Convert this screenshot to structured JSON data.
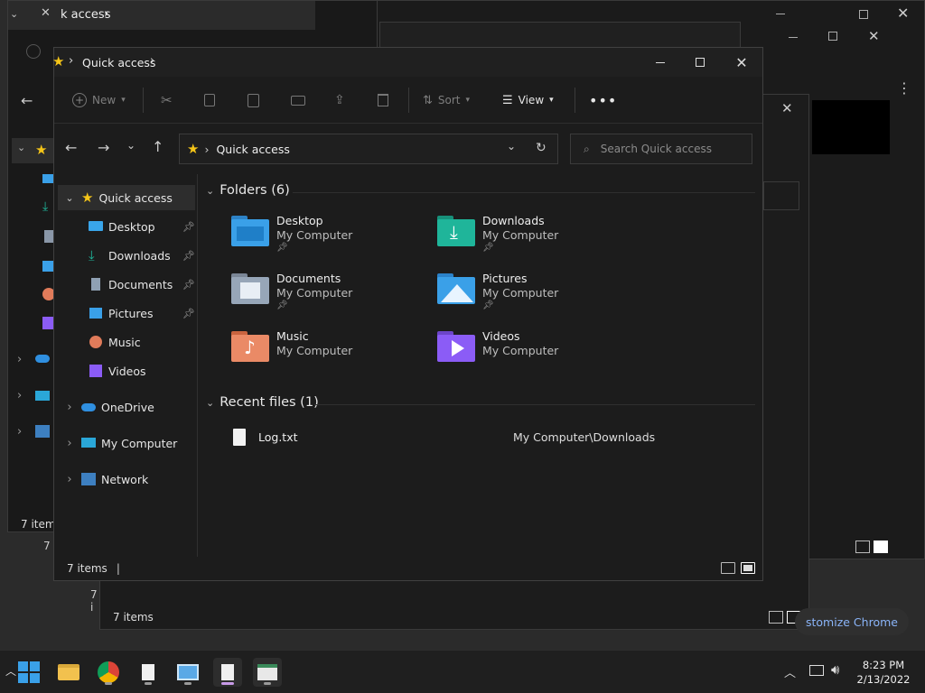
{
  "background_windows": {
    "top_title": "k access",
    "back_status": "7 items",
    "back2_status": "7 i",
    "back3_status": "7 i",
    "lower_status": "7 items",
    "chrome_label": "stomize Chrome"
  },
  "window": {
    "title": "Quick access",
    "toolbar": {
      "new_label": "New",
      "sort_label": "Sort",
      "view_label": "View"
    },
    "address": {
      "location": "Quick access"
    },
    "search": {
      "placeholder": "Search Quick access"
    },
    "nav": {
      "items": [
        {
          "label": "Quick access",
          "icon": "star-icon"
        },
        {
          "label": "Desktop",
          "icon": "desktop-icon",
          "pinned": true
        },
        {
          "label": "Downloads",
          "icon": "download-icon",
          "pinned": true
        },
        {
          "label": "Documents",
          "icon": "document-icon",
          "pinned": true
        },
        {
          "label": "Pictures",
          "icon": "pictures-icon",
          "pinned": true
        },
        {
          "label": "Music",
          "icon": "music-icon"
        },
        {
          "label": "Videos",
          "icon": "videos-icon"
        },
        {
          "label": "OneDrive",
          "icon": "cloud-icon"
        },
        {
          "label": "My Computer",
          "icon": "monitor-icon"
        },
        {
          "label": "Network",
          "icon": "network-icon"
        }
      ]
    },
    "folders_header": "Folders (6)",
    "folders": [
      {
        "name": "Desktop",
        "location": "My Computer",
        "pinned": true,
        "icon": "folder-desktop-icon"
      },
      {
        "name": "Downloads",
        "location": "My Computer",
        "pinned": true,
        "icon": "folder-downloads-icon"
      },
      {
        "name": "Documents",
        "location": "My Computer",
        "pinned": true,
        "icon": "folder-documents-icon"
      },
      {
        "name": "Pictures",
        "location": "My Computer",
        "pinned": true,
        "icon": "folder-pictures-icon"
      },
      {
        "name": "Music",
        "location": "My Computer",
        "pinned": false,
        "icon": "folder-music-icon"
      },
      {
        "name": "Videos",
        "location": "My Computer",
        "pinned": false,
        "icon": "folder-videos-icon"
      }
    ],
    "recent_header": "Recent files (1)",
    "recent": [
      {
        "name": "Log.txt",
        "path": "My Computer\\Downloads"
      }
    ],
    "status": "7 items"
  },
  "taskbar": {
    "time": "8:23 PM",
    "date": "2/13/2022"
  },
  "colors": {
    "accent_star": "#f5c518",
    "folder_blue": "#3aa0e8",
    "folder_teal": "#1fb59a"
  }
}
